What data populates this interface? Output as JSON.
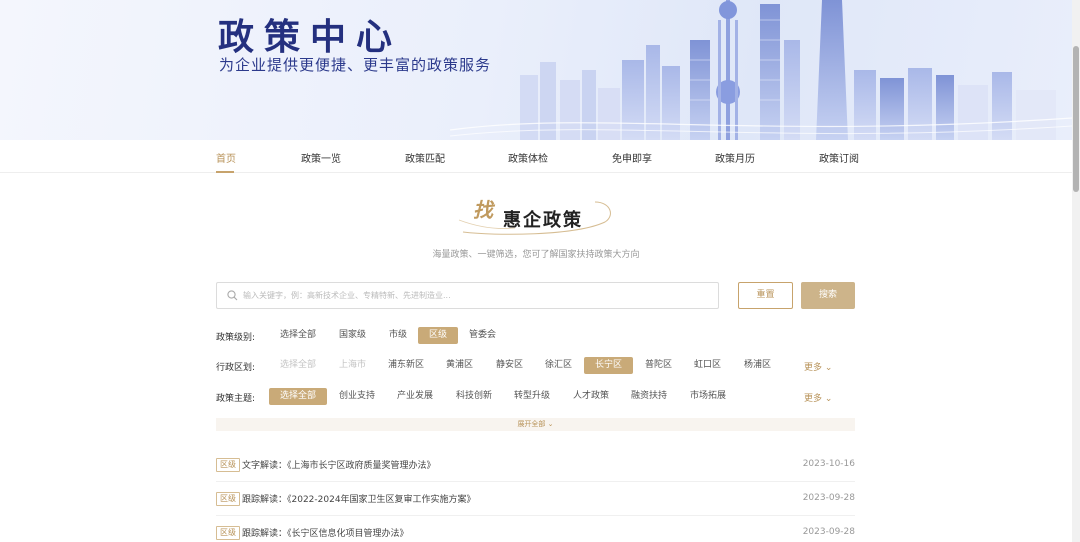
{
  "banner": {
    "title": "政策中心",
    "subtitle": "为企业提供更便捷、更丰富的政策服务"
  },
  "nav": {
    "items": [
      {
        "label": "首页",
        "active": true
      },
      {
        "label": "政策一览",
        "active": false
      },
      {
        "label": "政策匹配",
        "active": false
      },
      {
        "label": "政策体检",
        "active": false
      },
      {
        "label": "免申即享",
        "active": false
      },
      {
        "label": "政策月历",
        "active": false
      },
      {
        "label": "政策订阅",
        "active": false
      }
    ]
  },
  "heading": {
    "find": "找",
    "title": "惠企政策",
    "subtitle": "海量政策、一键筛选，您可了解国家扶持政策大方向"
  },
  "search": {
    "placeholder": "输入关键字，例：高新技术企业、专精特新、先进制造业...",
    "value": "",
    "reset_label": "重置",
    "search_label": "搜索"
  },
  "filters": {
    "level": {
      "label": "政策级别:",
      "options": [
        "选择全部",
        "国家级",
        "市级",
        "区级",
        "管委会"
      ],
      "selected": "区级"
    },
    "district": {
      "label": "行政区划:",
      "options": [
        "选择全部",
        "上海市",
        "浦东新区",
        "黄浦区",
        "静安区",
        "徐汇区",
        "长宁区",
        "普陀区",
        "虹口区",
        "杨浦区"
      ],
      "selected": "长宁区",
      "muted": [
        "选择全部",
        "上海市"
      ],
      "more": "更多"
    },
    "theme": {
      "label": "政策主题:",
      "options": [
        "选择全部",
        "创业支持",
        "产业发展",
        "科技创新",
        "转型升级",
        "人才政策",
        "融资扶持",
        "市场拓展"
      ],
      "selected": "选择全部",
      "more": "更多"
    },
    "expand_label": "展开全部"
  },
  "policies": [
    {
      "badge": "区级",
      "title": "文字解读：《上海市长宁区政府质量奖管理办法》",
      "date": "2023-10-16"
    },
    {
      "badge": "区级",
      "title": "跟踪解读：《2022-2024年国家卫生区复审工作实施方案》",
      "date": "2023-09-28"
    },
    {
      "badge": "区级",
      "title": "跟踪解读：《长宁区信息化项目管理办法》",
      "date": "2023-09-28"
    }
  ],
  "colors": {
    "accent": "#c9aa78",
    "accent_text": "#b8935a",
    "banner_title": "#24307f"
  }
}
